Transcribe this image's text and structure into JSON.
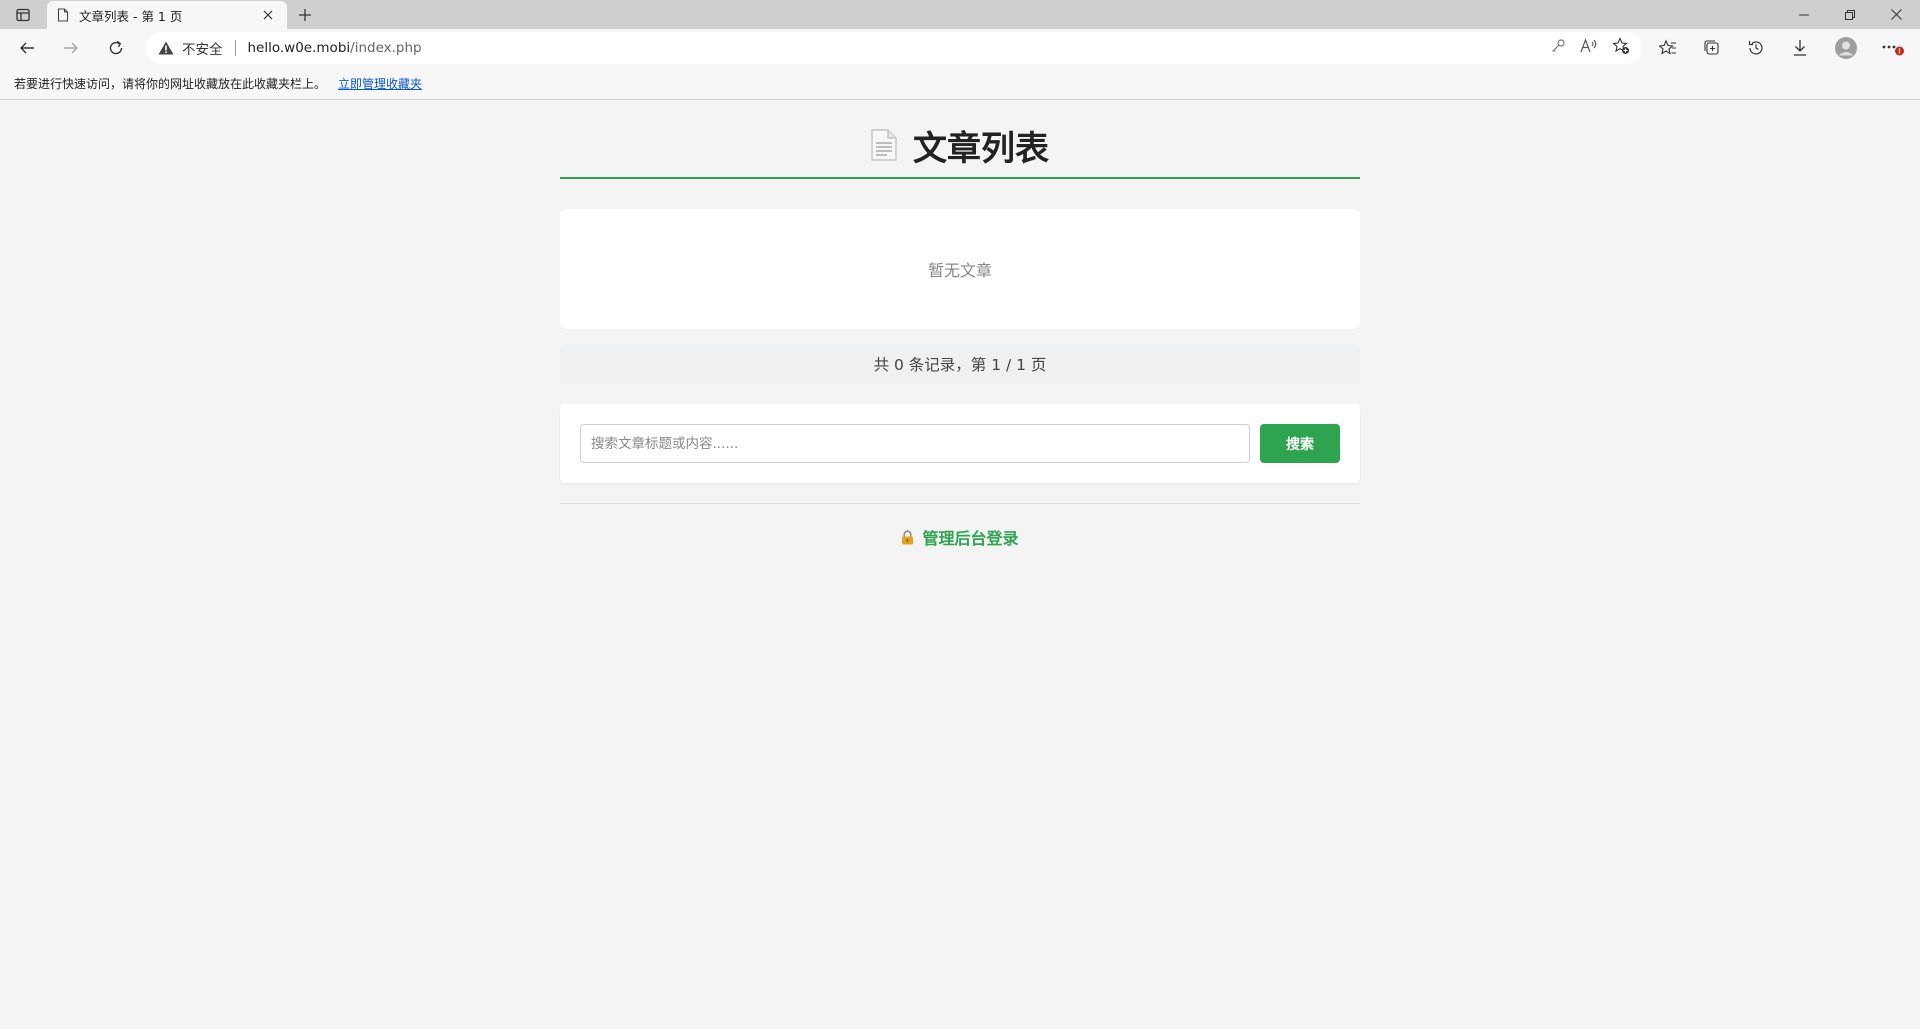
{
  "browser": {
    "tab_title": "文章列表 - 第 1 页",
    "security_label": "不安全",
    "url_host": "hello.w0e.mobi",
    "url_path": "/index.php",
    "favbar_text": "若要进行快速访问，请将你的网址收藏放在此收藏夹栏上。",
    "favbar_link": "立即管理收藏夹"
  },
  "page": {
    "title": "文章列表",
    "empty_text": "暂无文章",
    "pagination_text": "共 0 条记录，第 1 / 1 页",
    "search_placeholder": "搜索文章标题或内容......",
    "search_button": "搜索",
    "admin_login": "管理后台登录"
  },
  "colors": {
    "accent": "#2ea44f",
    "background": "#f4f4f4"
  }
}
